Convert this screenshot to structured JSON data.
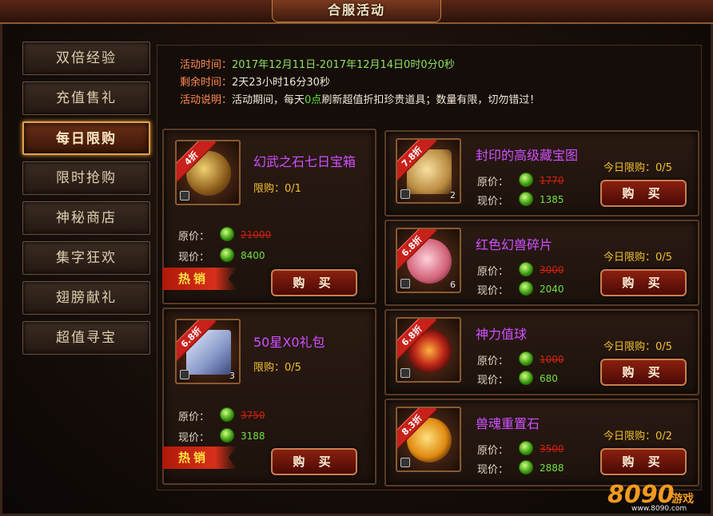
{
  "window": {
    "title": "合服活动"
  },
  "sidebar": {
    "items": [
      {
        "label": "双倍经验"
      },
      {
        "label": "充值售礼"
      },
      {
        "label": "每日限购",
        "active": true
      },
      {
        "label": "限时抢购"
      },
      {
        "label": "神秘商店"
      },
      {
        "label": "集字狂欢"
      },
      {
        "label": "翅膀献礼"
      },
      {
        "label": "超值寻宝"
      }
    ]
  },
  "info": {
    "time_label": "活动时间：",
    "time_value": "2017年12月11日-2017年12月14日0时0分0秒",
    "remain_label": "剩余时间：",
    "remain_value": "2天23小时16分30秒",
    "desc_label": "活动说明：",
    "desc_pre": "活动期间，每天",
    "desc_hl": "0点",
    "desc_post": "刷新超值折扣珍贵道具；数量有限，切勿错过！"
  },
  "labels": {
    "orig_price": "原价：",
    "now_price": "现价：",
    "buy": "购 买",
    "hot": "热销"
  },
  "colors": {
    "accent": "#e0a050",
    "name": "#d050ff",
    "limit": "#f0c030",
    "price_now": "#70e040",
    "price_old": "#d02010"
  },
  "left_items": [
    {
      "discount": "4折",
      "name": "幻武之石七日宝箱",
      "limit": "限购：0/1",
      "orig": "21000",
      "now": "8400",
      "count": "",
      "art_color": "#c8962a",
      "icon": "treasure-chest-icon"
    },
    {
      "discount": "6.8折",
      "name": "50星X0礼包",
      "limit": "限购：0/5",
      "orig": "3750",
      "now": "3188",
      "count": "3",
      "art_color": "#a8b8e0",
      "icon": "gift-box-icon"
    }
  ],
  "right_items": [
    {
      "discount": "7.8折",
      "name": "封印的高级藏宝图",
      "limit": "今日限购：0/5",
      "orig": "1770",
      "now": "1385",
      "count": "2",
      "art_color": "#d8b870",
      "icon": "treasure-map-icon"
    },
    {
      "discount": "6.8折",
      "name": "红色幻兽碎片",
      "limit": "今日限购：0/5",
      "orig": "3000",
      "now": "2040",
      "count": "6",
      "art_color": "#e07088",
      "icon": "beast-shard-icon"
    },
    {
      "discount": "6.8折",
      "name": "神力值球",
      "limit": "今日限购：0/5",
      "orig": "1000",
      "now": "680",
      "count": "",
      "art_color": "#c02818",
      "icon": "power-orb-icon"
    },
    {
      "discount": "8.3折",
      "name": "兽魂重置石",
      "limit": "今日限购：0/2",
      "orig": "3500",
      "now": "2888",
      "count": "",
      "art_color": "#f0a020",
      "icon": "beast-soul-stone-icon"
    }
  ],
  "logo": {
    "number": "8090",
    "text": "游戏",
    "url": "www.8090.com"
  }
}
